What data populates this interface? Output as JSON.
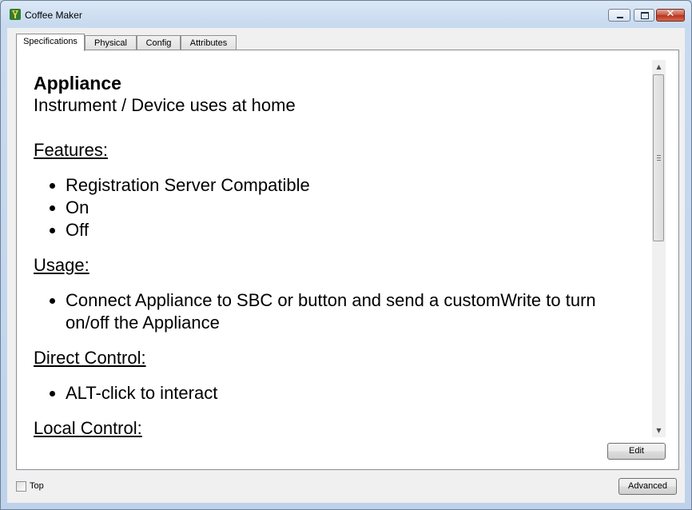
{
  "window": {
    "title": "Coffee Maker",
    "icon": "coffee-maker-app-icon"
  },
  "tabs": [
    {
      "label": "Specifications",
      "active": true
    },
    {
      "label": "Physical",
      "active": false
    },
    {
      "label": "Config",
      "active": false
    },
    {
      "label": "Attributes",
      "active": false
    }
  ],
  "spec": {
    "heading": "Appliance",
    "subtitle": "Instrument / Device uses at home",
    "features_heading": "Features:",
    "features": [
      "Registration Server Compatible",
      "On",
      "Off"
    ],
    "usage_heading": "Usage:",
    "usage": [
      "Connect Appliance to SBC or button and send a customWrite to turn on/off the Appliance"
    ],
    "direct_heading": "Direct Control:",
    "direct": [
      "ALT-click to interact"
    ],
    "local_heading": "Local Control:"
  },
  "buttons": {
    "edit": "Edit",
    "advanced": "Advanced"
  },
  "top_checkbox": {
    "label": "Top",
    "checked": false
  },
  "colors": {
    "title_bar": "#c8daef",
    "close_button": "#c65541"
  }
}
